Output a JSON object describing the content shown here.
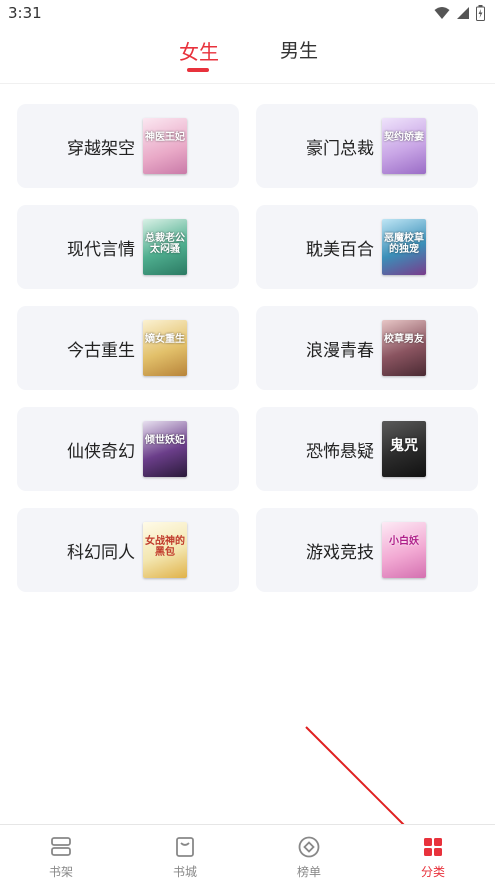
{
  "status_bar": {
    "time": "3:31",
    "icons": [
      "wifi-icon",
      "signal-icon",
      "battery-icon"
    ]
  },
  "top_tabs": [
    {
      "label": "女生",
      "active": true
    },
    {
      "label": "男生",
      "active": false
    }
  ],
  "categories": [
    {
      "label": "穿越架空",
      "cover_icon": "book-cover-thumbnail",
      "cover_text": "神医王妃",
      "cover_color": "#e9a9c7"
    },
    {
      "label": "豪门总裁",
      "cover_icon": "book-cover-thumbnail",
      "cover_text": "契约娇妻",
      "cover_color": "#c9a6e6"
    },
    {
      "label": "现代言情",
      "cover_icon": "book-cover-thumbnail",
      "cover_text": "总裁老公太闷骚",
      "cover_color": "#4fae8f"
    },
    {
      "label": "耽美百合",
      "cover_icon": "book-cover-thumbnail",
      "cover_text": "恶魔校草的独宠",
      "cover_color": "#3b8fb8"
    },
    {
      "label": "今古重生",
      "cover_icon": "book-cover-thumbnail",
      "cover_text": "嫡女重生",
      "cover_color": "#e2c06a"
    },
    {
      "label": "浪漫青春",
      "cover_icon": "book-cover-thumbnail",
      "cover_text": "校草男友",
      "cover_color": "#8a5460"
    },
    {
      "label": "仙侠奇幻",
      "cover_icon": "book-cover-thumbnail",
      "cover_text": "倾世妖妃",
      "cover_color": "#6b3e8a"
    },
    {
      "label": "恐怖悬疑",
      "cover_icon": "book-cover-thumbnail",
      "cover_text": "鬼咒",
      "cover_color": "#2b2b2b"
    },
    {
      "label": "科幻同人",
      "cover_icon": "book-cover-thumbnail",
      "cover_text": "女战神的黑包",
      "cover_color": "#f3e6b0"
    },
    {
      "label": "游戏竞技",
      "cover_icon": "book-cover-thumbnail",
      "cover_text": "小白妖",
      "cover_color": "#f2a9d3"
    }
  ],
  "bottom_nav": [
    {
      "label": "书架",
      "icon": "bookshelf-icon",
      "active": false
    },
    {
      "label": "书城",
      "icon": "bookstore-icon",
      "active": false
    },
    {
      "label": "榜单",
      "icon": "ranking-icon",
      "active": false
    },
    {
      "label": "分类",
      "icon": "category-grid-icon",
      "active": true
    }
  ],
  "colors": {
    "accent": "#e8323c",
    "card_bg": "#f4f5f9",
    "inactive_text": "#888888",
    "annotation_arrow": "#e02020"
  }
}
